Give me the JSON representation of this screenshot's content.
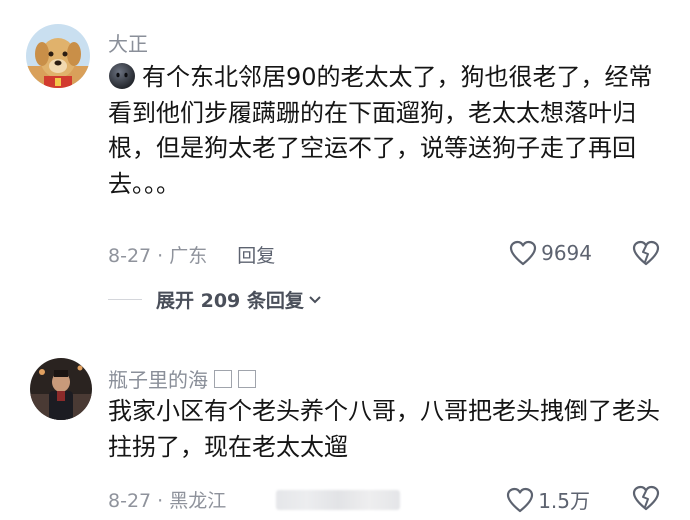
{
  "comments": [
    {
      "username": "大正",
      "emoji": "dark-round-face-emoji",
      "text": "有个东北邻居90的老太太了，狗也很老了，经常看到他们步履蹒跚的在下面遛狗，老太太想落叶归根，但是狗太老了空运不了，说等送狗子走了再回去。。。",
      "date": "8-27",
      "location": "广东",
      "date_location": "8-27 · 广东",
      "reply_label": "回复",
      "likes": "9694",
      "expand_label": "展开 209 条回复"
    },
    {
      "username": "瓶子里的海",
      "text": "我家小区有个老头养个八哥，八哥把老头拽倒了老头拄拐了，现在老太太遛",
      "date": "8-27",
      "location": "黑龙江",
      "date_location": "8-27 · 黑龙江",
      "likes": "1.5万"
    }
  ],
  "colors": {
    "meta": "#8f939c",
    "username": "#8a8f99",
    "text": "#151515",
    "icon": "#5d6370"
  },
  "icons": {
    "like": "heart-outline-icon",
    "dislike": "broken-heart-icon",
    "expand": "chevron-down-icon"
  }
}
